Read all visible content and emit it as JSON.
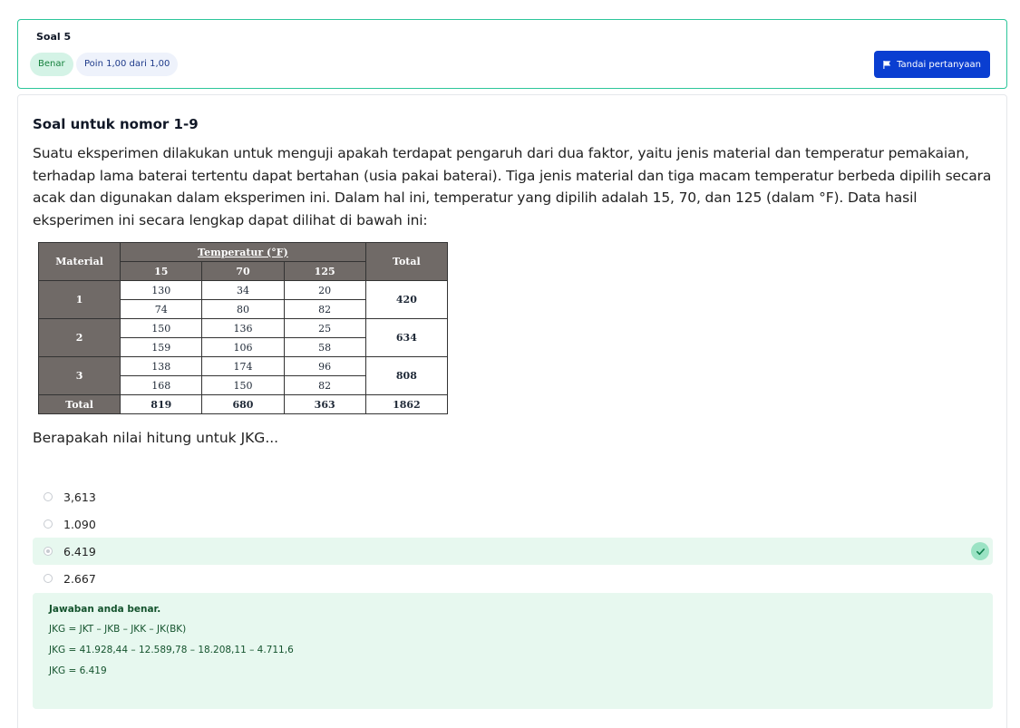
{
  "question": {
    "number_label": "Soal 5",
    "status_badge": "Benar",
    "points_badge": "Poin 1,00 dari 1,00",
    "flag_label": "Tandai pertanyaan"
  },
  "content": {
    "title": "Soal untuk nomor 1-9",
    "text": "Suatu eksperimen dilakukan untuk menguji apakah terdapat pengaruh dari dua faktor, yaitu jenis material dan temperatur pemakaian, terhadap lama baterai tertentu dapat bertahan (usia pakai baterai). Tiga jenis material dan tiga macam temperatur berbeda dipilih secara acak dan digunakan dalam eksperimen ini. Dalam hal ini, temperatur yang dipilih adalah 15, 70, dan 125 (dalam °F). Data hasil eksperimen ini secara lengkap dapat dilihat di bawah ini:",
    "prompt": "Berapakah nilai hitung untuk JKG..."
  },
  "table": {
    "header_material": "Material",
    "header_temperature": "Temperatur (°F)",
    "header_total": "Total",
    "temps": [
      "15",
      "70",
      "125"
    ],
    "groups": [
      {
        "material": "1",
        "rows": [
          [
            "130",
            "34",
            "20"
          ],
          [
            "74",
            "80",
            "82"
          ]
        ],
        "total": "420"
      },
      {
        "material": "2",
        "rows": [
          [
            "150",
            "136",
            "25"
          ],
          [
            "159",
            "106",
            "58"
          ]
        ],
        "total": "634"
      },
      {
        "material": "3",
        "rows": [
          [
            "138",
            "174",
            "96"
          ],
          [
            "168",
            "150",
            "82"
          ]
        ],
        "total": "808"
      }
    ],
    "total_row": {
      "label": "Total",
      "values": [
        "819",
        "680",
        "363"
      ],
      "grand_total": "1862"
    }
  },
  "options": [
    {
      "label": "3,613",
      "selected": false
    },
    {
      "label": "1.090",
      "selected": false
    },
    {
      "label": "6.419",
      "selected": true,
      "correct": true
    },
    {
      "label": "2.667",
      "selected": false
    }
  ],
  "feedback": {
    "title": "Jawaban anda benar.",
    "lines": [
      "JKG = JKT – JKB – JKK – JK(BK)",
      "JKG = 41.928,44 – 12.589,78 – 18.208,11 – 4.711,6",
      "JKG = 6.419"
    ]
  },
  "colors": {
    "accent_border": "#2cc69a",
    "primary_button": "#0a3ed1",
    "success_bg": "#e7f8ef",
    "table_header_bg": "#706a67"
  }
}
